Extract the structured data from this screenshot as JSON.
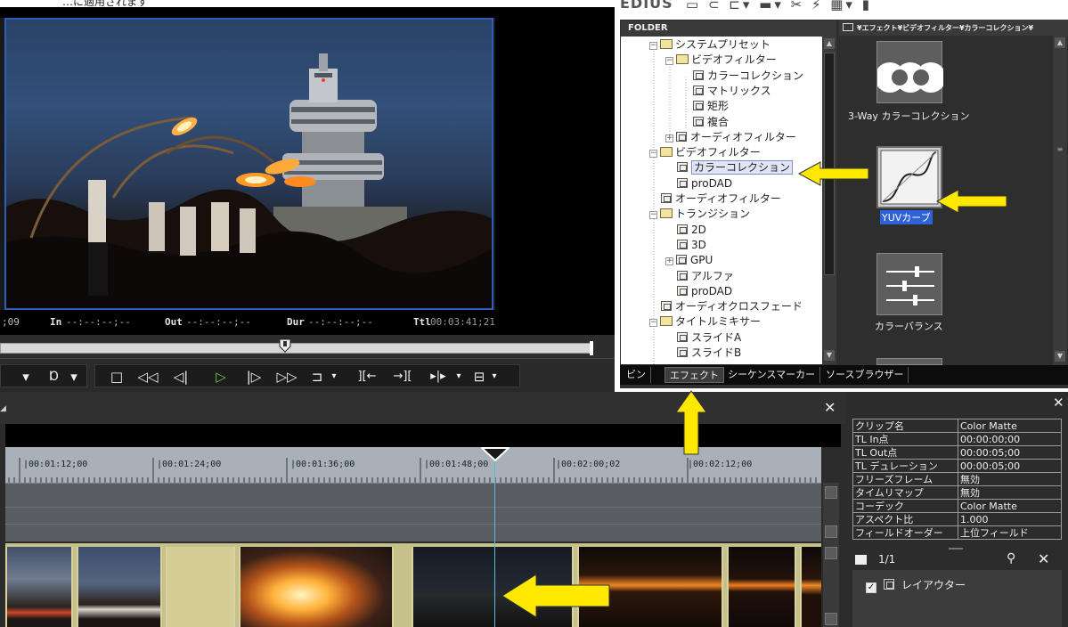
{
  "caption": {
    "text": "…に適用されます"
  },
  "player": {
    "timecode": {
      "cur": ";09",
      "in_label": "In",
      "in_val": "--:--:--;--",
      "out_label": "Out",
      "out_val": "--:--:--;--",
      "dur_label": "Dur",
      "dur_val": "--:--:--;--",
      "ttl_label": "Ttl",
      "ttl_val": "00:03:41;21"
    },
    "scrubber_position": 0.48,
    "transport": {
      "mark_in": "▾",
      "mark_out": "▾",
      "stop": "□",
      "rewind": "◁◁",
      "step_back": "◁|",
      "play": "▷",
      "step_fwd": "|▷",
      "fast_fwd": "▷▷",
      "loop": "⊐",
      "insert_in": "][←",
      "insert_out": "→][",
      "split": "▸|▸",
      "misc": "⊟"
    }
  },
  "effects": {
    "app_logo": "EDIUS",
    "folder_header": "FOLDER",
    "tree": [
      {
        "label": "システムプリセット",
        "indent": 0,
        "exp": "−",
        "icon": "folder"
      },
      {
        "label": "ビデオフィルター",
        "indent": 1,
        "exp": "−",
        "icon": "folder"
      },
      {
        "label": "カラーコレクション",
        "indent": 2,
        "exp": "",
        "icon": "fx"
      },
      {
        "label": "マトリックス",
        "indent": 2,
        "exp": "",
        "icon": "fx"
      },
      {
        "label": "矩形",
        "indent": 2,
        "exp": "",
        "icon": "fx"
      },
      {
        "label": "複合",
        "indent": 2,
        "exp": "",
        "icon": "fx"
      },
      {
        "label": "オーディオフィルター",
        "indent": 1,
        "exp": "+",
        "icon": "fx"
      },
      {
        "label": "ビデオフィルター",
        "indent": 0,
        "exp": "−",
        "icon": "folder"
      },
      {
        "label": "カラーコレクション",
        "indent": 1,
        "exp": "",
        "icon": "fx",
        "selected": true
      },
      {
        "label": "proDAD",
        "indent": 1,
        "exp": "",
        "icon": "fx"
      },
      {
        "label": "オーディオフィルター",
        "indent": 0,
        "exp": "",
        "icon": "fx"
      },
      {
        "label": "トランジション",
        "indent": 0,
        "exp": "−",
        "icon": "folder"
      },
      {
        "label": "2D",
        "indent": 1,
        "exp": "",
        "icon": "fx"
      },
      {
        "label": "3D",
        "indent": 1,
        "exp": "",
        "icon": "fx"
      },
      {
        "label": "GPU",
        "indent": 1,
        "exp": "+",
        "icon": "fx"
      },
      {
        "label": "アルファ",
        "indent": 1,
        "exp": "",
        "icon": "fx"
      },
      {
        "label": "proDAD",
        "indent": 1,
        "exp": "",
        "icon": "fx"
      },
      {
        "label": "オーディオクロスフェード",
        "indent": 0,
        "exp": "",
        "icon": "fx"
      },
      {
        "label": "タイトルミキサー",
        "indent": 0,
        "exp": "−",
        "icon": "folder"
      },
      {
        "label": "スライドA",
        "indent": 1,
        "exp": "",
        "icon": "title"
      },
      {
        "label": "スライドB",
        "indent": 1,
        "exp": "",
        "icon": "title"
      }
    ],
    "breadcrumb": "¥エフェクト¥ビデオフィルター¥カラーコレクション¥",
    "items": [
      {
        "name": "3-Way カラーコレクション",
        "thumb": "threeway"
      },
      {
        "name": "YUVカーブ",
        "thumb": "curve",
        "selected": true
      },
      {
        "name": "カラーバランス",
        "thumb": "balance"
      }
    ],
    "tabs": [
      {
        "label": "ビン"
      },
      {
        "label": "エフェクト",
        "active": true
      },
      {
        "label": "シーケンスマーカー"
      },
      {
        "label": "ソースブラウザー"
      }
    ]
  },
  "timeline": {
    "ruler_labels": [
      "|00:01:12;00",
      "|00:01:24;00",
      "|00:01:36;00",
      "|00:01:48;00",
      "|00:02:00;02",
      "|00:02:12;00"
    ]
  },
  "info": {
    "rows": [
      {
        "k": "クリップ名",
        "v": "Color Matte"
      },
      {
        "k": "TL In点",
        "v": "00:00:00;00"
      },
      {
        "k": "TL Out点",
        "v": "00:00:05;00"
      },
      {
        "k": "TL デュレーション",
        "v": "00:00:05;00"
      },
      {
        "k": "フリーズフレーム",
        "v": "無効"
      },
      {
        "k": "タイムリマップ",
        "v": "無効"
      },
      {
        "k": "コーデック",
        "v": "Color Matte"
      },
      {
        "k": "アスペクト比",
        "v": "1.000"
      },
      {
        "k": "フィールドオーダー",
        "v": "上位フィールド"
      }
    ],
    "page": "1/1",
    "layer_name": "レイアウター",
    "layer_checked": "✓"
  },
  "colors": {
    "annotation_arrow": "#ffe800",
    "selection": "#2f62d9",
    "playhead": "#4fc3d1",
    "play": "#6ad04a"
  }
}
